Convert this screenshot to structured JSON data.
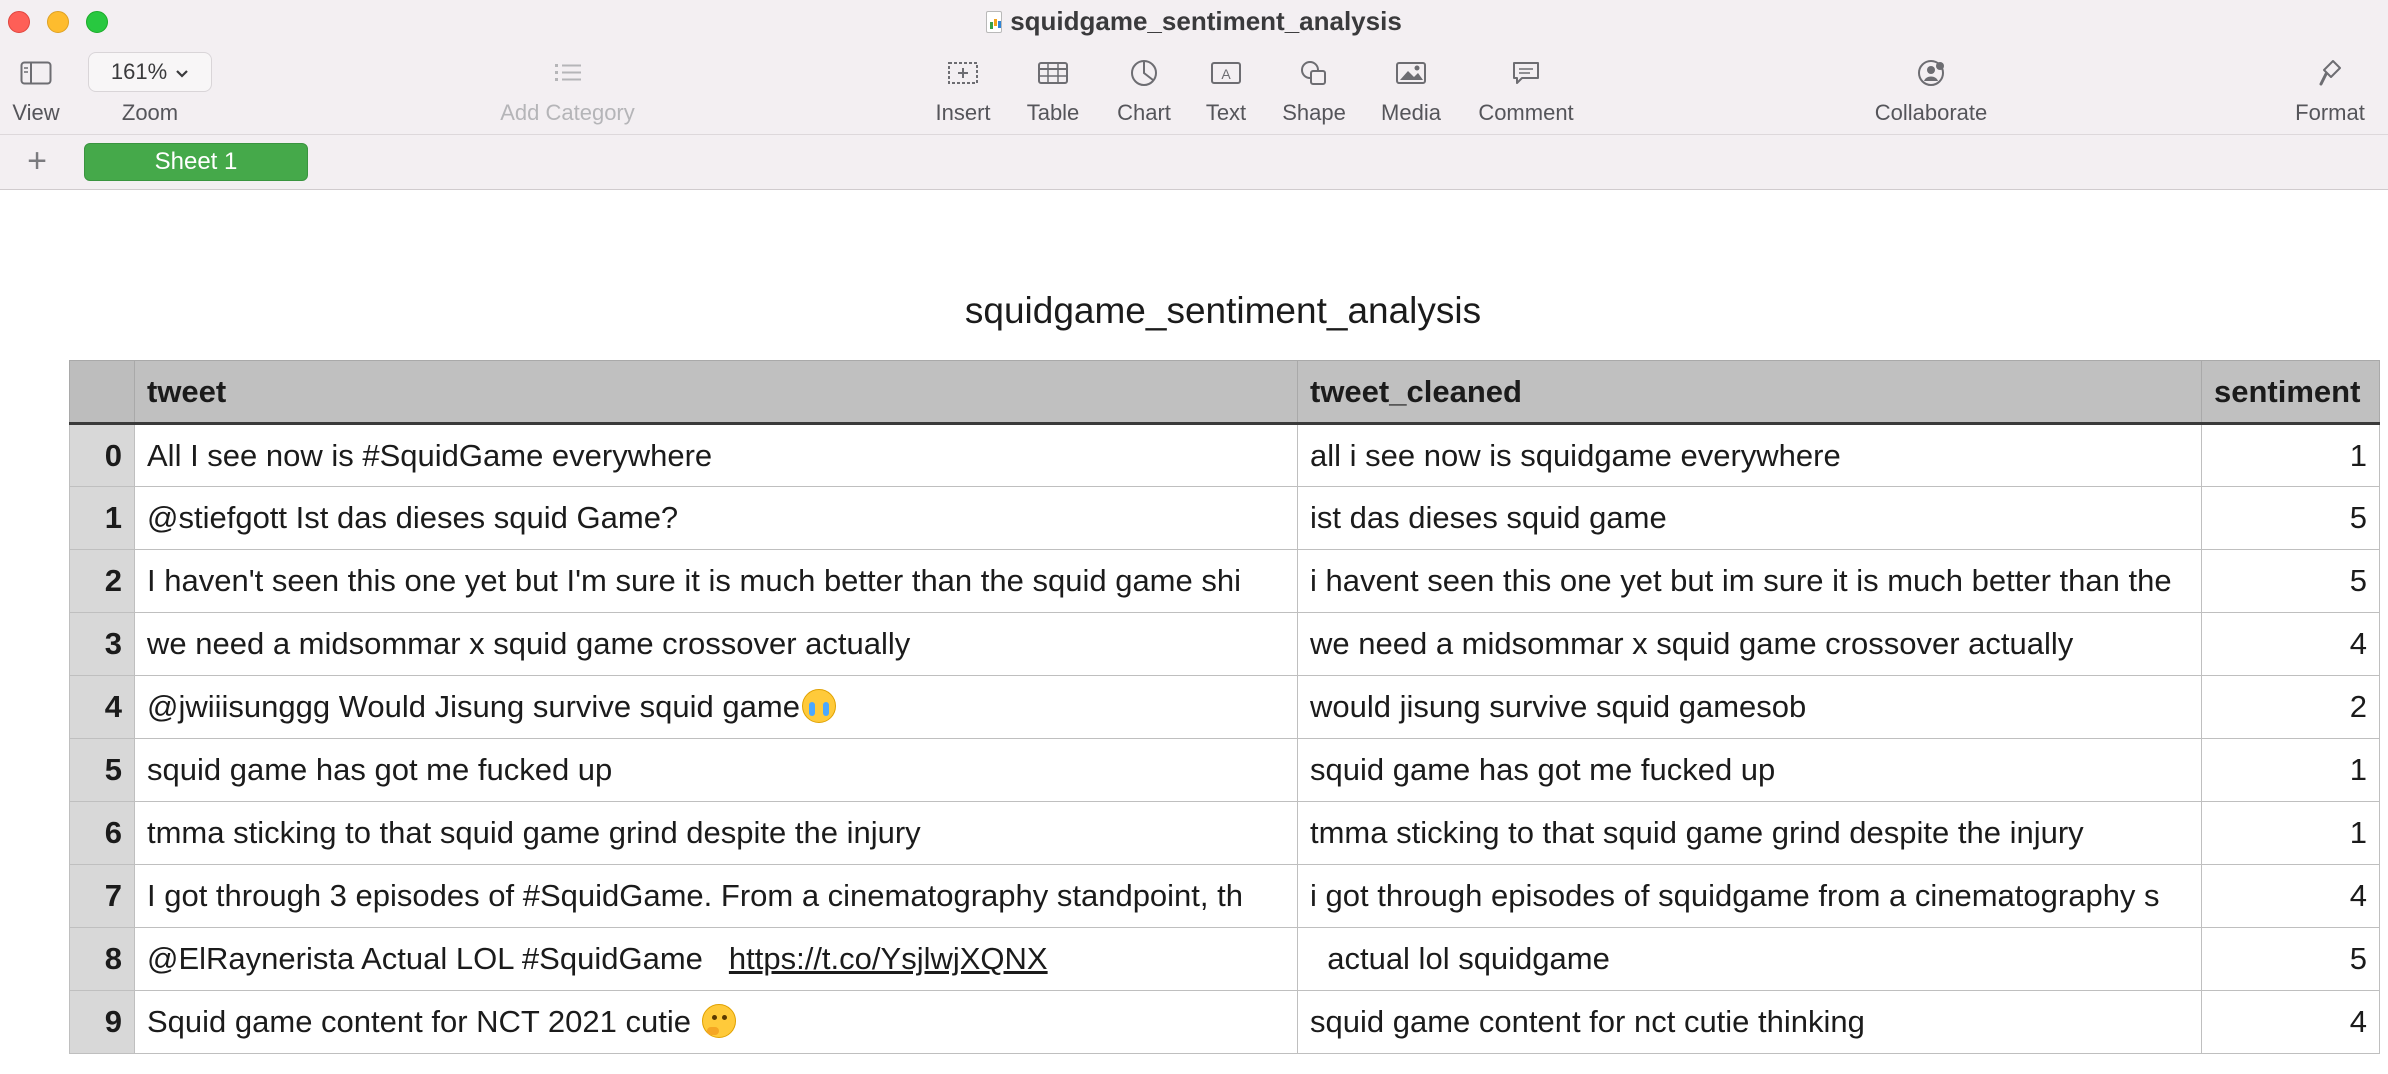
{
  "window": {
    "title": "squidgame_sentiment_analysis"
  },
  "toolbar": {
    "view_label": "View",
    "zoom_label": "Zoom",
    "zoom_value": "161%",
    "add_category_label": "Add Category",
    "insert_label": "Insert",
    "table_label": "Table",
    "chart_label": "Chart",
    "text_label": "Text",
    "shape_label": "Shape",
    "media_label": "Media",
    "comment_label": "Comment",
    "collaborate_label": "Collaborate",
    "format_label": "Format"
  },
  "sheets": {
    "add_symbol": "+",
    "tabs": [
      {
        "label": "Sheet 1",
        "active": true,
        "color": "#45a94a"
      }
    ]
  },
  "table": {
    "title": "squidgame_sentiment_analysis",
    "columns": [
      "",
      "tweet",
      "tweet_cleaned",
      "sentiment"
    ],
    "rows": [
      {
        "index": "0",
        "tweet": "All I see now is #SquidGame everywhere",
        "tweet_cleaned": "all i see now is squidgame everywhere",
        "sentiment": "1"
      },
      {
        "index": "1",
        "tweet": "@stiefgott Ist das dieses squid Game?",
        "tweet_cleaned": " ist das dieses squid game",
        "sentiment": "5"
      },
      {
        "index": "2",
        "tweet": "I haven't seen this one yet but I'm sure it is much better than the squid game shi",
        "tweet_cleaned": "i havent seen this one yet but im sure it is much better than the",
        "sentiment": "5"
      },
      {
        "index": "3",
        "tweet": "we need a midsommar x squid game crossover actually",
        "tweet_cleaned": "we need a midsommar x squid game crossover actually",
        "sentiment": "4"
      },
      {
        "index": "4",
        "tweet": "@jwiiisunggg Would Jisung survive squid game",
        "tweet_cleaned": " would jisung survive squid gamesob",
        "sentiment": "2",
        "emoji": "sob-emoji"
      },
      {
        "index": "5",
        "tweet": "squid game has got me fucked up",
        "tweet_cleaned": "squid game has got me fucked up",
        "sentiment": "1"
      },
      {
        "index": "6",
        "tweet": "tmma sticking to that squid game grind despite the injury",
        "tweet_cleaned": "tmma sticking to that squid game grind despite the injury",
        "sentiment": "1"
      },
      {
        "index": "7",
        "tweet": "I got through 3 episodes of #SquidGame. From a cinematography standpoint, th",
        "tweet_cleaned": "i got through  episodes of squidgame from a cinematography s",
        "sentiment": "4"
      },
      {
        "index": "8",
        "tweet": "@ElRaynerista  Actual LOL #SquidGame",
        "tweet_link": "https://t.co/YsjlwjXQNX",
        "tweet_cleaned": "  actual lol squidgame",
        "sentiment": "5"
      },
      {
        "index": "9",
        "tweet": "Squid game content for NCT 2021 cutie",
        "tweet_cleaned": "squid game content for nct  cutie thinking",
        "sentiment": "4",
        "emoji": "thinking-emoji"
      }
    ]
  }
}
